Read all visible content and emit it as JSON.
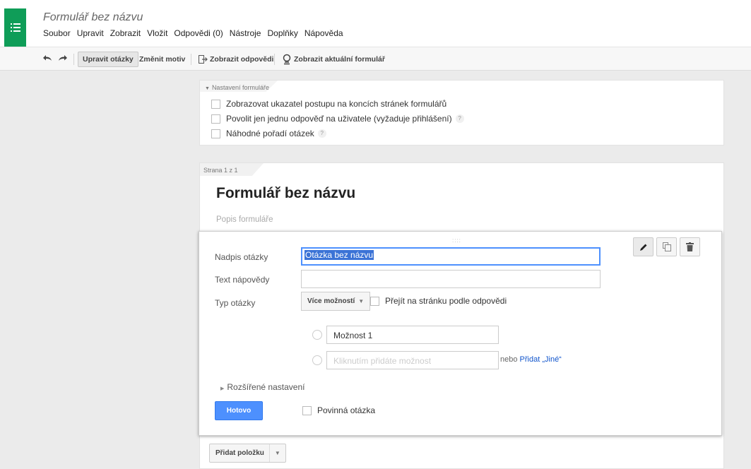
{
  "header": {
    "doc_title": "Formulář bez názvu",
    "menu": [
      "Soubor",
      "Upravit",
      "Zobrazit",
      "Vložit",
      "Odpovědi (0)",
      "Nástroje",
      "Doplňky",
      "Nápověda"
    ]
  },
  "toolbar": {
    "edit_questions": "Upravit otázky",
    "change_theme": "Změnit motiv",
    "view_responses": "Zobrazit odpovědi",
    "view_live_form": "Zobrazit aktuální formulář"
  },
  "settings": {
    "heading": "Nastavení formuláře",
    "options": [
      {
        "label": "Zobrazovat ukazatel postupu na koncích stránek formulářů",
        "checked": false,
        "help": false
      },
      {
        "label": "Povolit jen jednu odpověď na uživatele (vyžaduje přihlášení)",
        "checked": false,
        "help": true
      },
      {
        "label": "Náhodné pořadí otázek",
        "checked": false,
        "help": true
      }
    ],
    "help_glyph": "?"
  },
  "page": {
    "label": "Strana 1 z 1",
    "form_title": "Formulář bez názvu",
    "form_description_placeholder": "Popis formuláře"
  },
  "question": {
    "drag_handle": "::::",
    "title_label": "Nadpis otázky",
    "title_value": "Otázka bez názvu",
    "help_label": "Text nápovědy",
    "help_value": "",
    "type_label": "Typ otázky",
    "type_value": "Více možností",
    "goto_label": "Přejít na stránku podle odpovědi",
    "options": [
      {
        "value": "Možnost 1"
      }
    ],
    "add_option_placeholder": "Kliknutím přidáte možnost",
    "or_text": "nebo",
    "add_other": "Přidat „Jiné“",
    "advanced": "Rozšířené nastavení",
    "done": "Hotovo",
    "required": "Povinná otázka"
  },
  "add_item": {
    "label": "Přidat položku"
  },
  "colors": {
    "brand": "#0f9d58",
    "primary_button": "#4d90fe",
    "link": "#1155cc"
  }
}
